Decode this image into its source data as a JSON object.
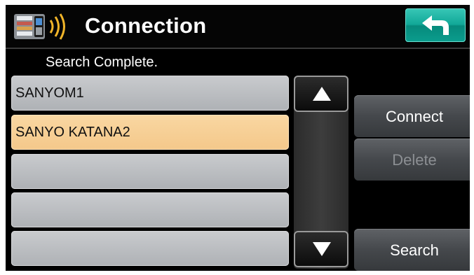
{
  "header": {
    "title": "Connection",
    "app_icon": "phone-bluetooth-icon",
    "back_icon": "back-arrow-icon"
  },
  "status_text": "Search Complete.",
  "devices": [
    {
      "label": "SANYOM1",
      "selected": false
    },
    {
      "label": "SANYO KATANA2",
      "selected": true
    },
    {
      "label": "",
      "selected": false
    },
    {
      "label": "",
      "selected": false
    },
    {
      "label": "",
      "selected": false
    }
  ],
  "buttons": {
    "connect": "Connect",
    "delete": "Delete",
    "search": "Search"
  },
  "colors": {
    "accent_teal": "#11a898",
    "selected_row": "#f4c88a",
    "row": "#b8babd",
    "background": "#000000"
  }
}
